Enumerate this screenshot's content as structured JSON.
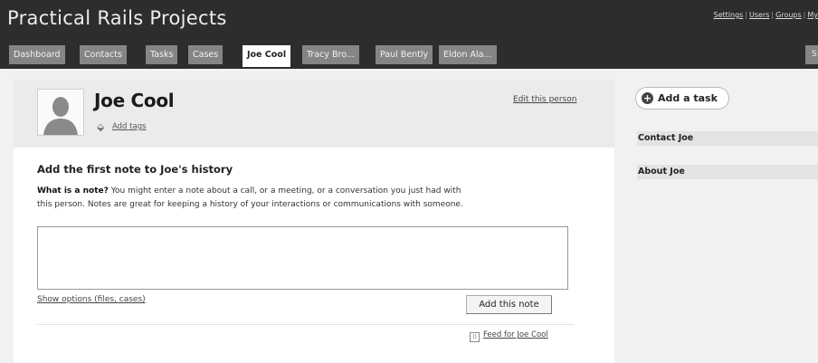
{
  "app": {
    "title": "Practical Rails Projects"
  },
  "top_links": [
    "Settings",
    "Users",
    "Groups",
    "My"
  ],
  "tabs": [
    "Dashboard",
    "Contacts",
    "Tasks",
    "Cases",
    "Joe Cool",
    "Tracy Bro...",
    "Paul Bently",
    "Eldon Ala..."
  ],
  "right_tab": "S",
  "person": {
    "name": "Joe Cool",
    "add_tags": "Add tags",
    "edit": "Edit this person"
  },
  "note": {
    "heading": "Add the first note to Joe's history",
    "help_bold": "What is a note?",
    "help_line1": " You might enter a note about a call, or a meeting, or a conversation you just had with",
    "help_line2": "this person. Notes are great for keeping a history of your interactions or communications with someone.",
    "body": "",
    "show_options": "Show options (files, cases)",
    "submit": "Add this note",
    "feed": "Feed for Joe Cool"
  },
  "sidebar": {
    "add_task": "Add a task",
    "contact": "Contact Joe",
    "about": "About Joe"
  }
}
